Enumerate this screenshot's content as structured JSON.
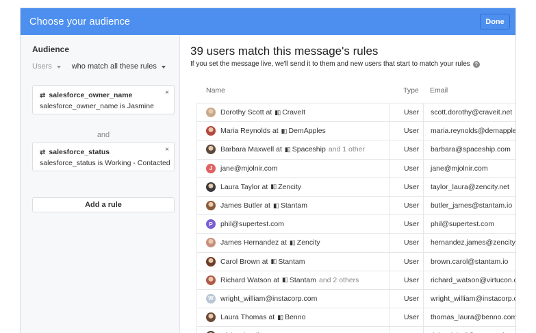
{
  "modal": {
    "title": "Choose your audience",
    "done_label": "Done"
  },
  "sidebar": {
    "heading": "Audience",
    "users_label": "Users",
    "match_label": "who match all these rules",
    "rules": [
      {
        "title": "salesforce_owner_name",
        "desc": "salesforce_owner_name is Jasmine",
        "close": "×"
      },
      {
        "title": "salesforce_status",
        "desc": "salesforce_status is Working - Contacted",
        "close": "×"
      }
    ],
    "and_label": "and",
    "add_rule_label": "Add a rule"
  },
  "main": {
    "title": "39 users match this message's rules",
    "subtitle": "If you set the message live, we'll send it to them and new users that start to match your rules",
    "help_icon": "?",
    "columns": {
      "name": "Name",
      "type": "Type",
      "email": "Email"
    }
  },
  "users": [
    {
      "name": "Dorothy Scott at",
      "company": "CraveIt",
      "extra": "",
      "type": "User",
      "email": "scott.dorothy@craveit.net",
      "avatar": "photo",
      "avatar_color": "#c9a98c",
      "avatar_letter": ""
    },
    {
      "name": "Maria Reynolds at",
      "company": "DemApples",
      "extra": "",
      "type": "User",
      "email": "maria.reynolds@demapples.io",
      "avatar": "photo",
      "avatar_color": "#b6473f",
      "avatar_letter": ""
    },
    {
      "name": "Barbara Maxwell at",
      "company": "Spaceship",
      "extra": "and 1 other",
      "type": "User",
      "email": "barbara@spaceship.com",
      "avatar": "photo",
      "avatar_color": "#5b4a3c",
      "avatar_letter": ""
    },
    {
      "name": "jane@mjolnir.com",
      "company": "",
      "extra": "",
      "type": "User",
      "email": "jane@mjolnir.com",
      "avatar": "letter",
      "avatar_color": "#e06161",
      "avatar_letter": "J"
    },
    {
      "name": "Laura Taylor at",
      "company": "Zencity",
      "extra": "",
      "type": "User",
      "email": "taylor_laura@zencity.net",
      "avatar": "photo",
      "avatar_color": "#3a3a3a",
      "avatar_letter": ""
    },
    {
      "name": "James Butler at",
      "company": "Stantam",
      "extra": "",
      "type": "User",
      "email": "butler_james@stantam.io",
      "avatar": "photo",
      "avatar_color": "#8a5a3a",
      "avatar_letter": ""
    },
    {
      "name": "phil@supertest.com",
      "company": "",
      "extra": "",
      "type": "User",
      "email": "phil@supertest.com",
      "avatar": "letter",
      "avatar_color": "#7a5fd6",
      "avatar_letter": "P"
    },
    {
      "name": "James Hernandez at",
      "company": "Zencity",
      "extra": "",
      "type": "User",
      "email": "hernandez.james@zencity.net",
      "avatar": "photo",
      "avatar_color": "#c98f7c",
      "avatar_letter": ""
    },
    {
      "name": "Carol Brown at",
      "company": "Stantam",
      "extra": "",
      "type": "User",
      "email": "brown.carol@stantam.io",
      "avatar": "photo",
      "avatar_color": "#6e3d2c",
      "avatar_letter": ""
    },
    {
      "name": "Richard Watson at",
      "company": "Stantam",
      "extra": "and 2 others",
      "type": "User",
      "email": "richard_watson@virtucon.com",
      "avatar": "photo",
      "avatar_color": "#b05a4a",
      "avatar_letter": ""
    },
    {
      "name": "wright_william@instacorp.com",
      "company": "",
      "extra": "",
      "type": "User",
      "email": "wright_william@instacorp.com",
      "avatar": "letter",
      "avatar_color": "#b9c6d6",
      "avatar_letter": "W"
    },
    {
      "name": "Laura Thomas at",
      "company": "Benno",
      "extra": "",
      "type": "User",
      "email": "thomas_laura@benno.com",
      "avatar": "photo",
      "avatar_color": "#6b4a36",
      "avatar_letter": ""
    },
    {
      "name": "Richard Bell at",
      "company": "Stantam",
      "extra": "",
      "type": "User",
      "email": "richard_bell@stantam.io",
      "avatar": "photo",
      "avatar_color": "#4a3a30",
      "avatar_letter": ""
    }
  ],
  "colors": {
    "header_blue": "#4c8fef",
    "sidebar_bg": "#f7f8fa"
  }
}
